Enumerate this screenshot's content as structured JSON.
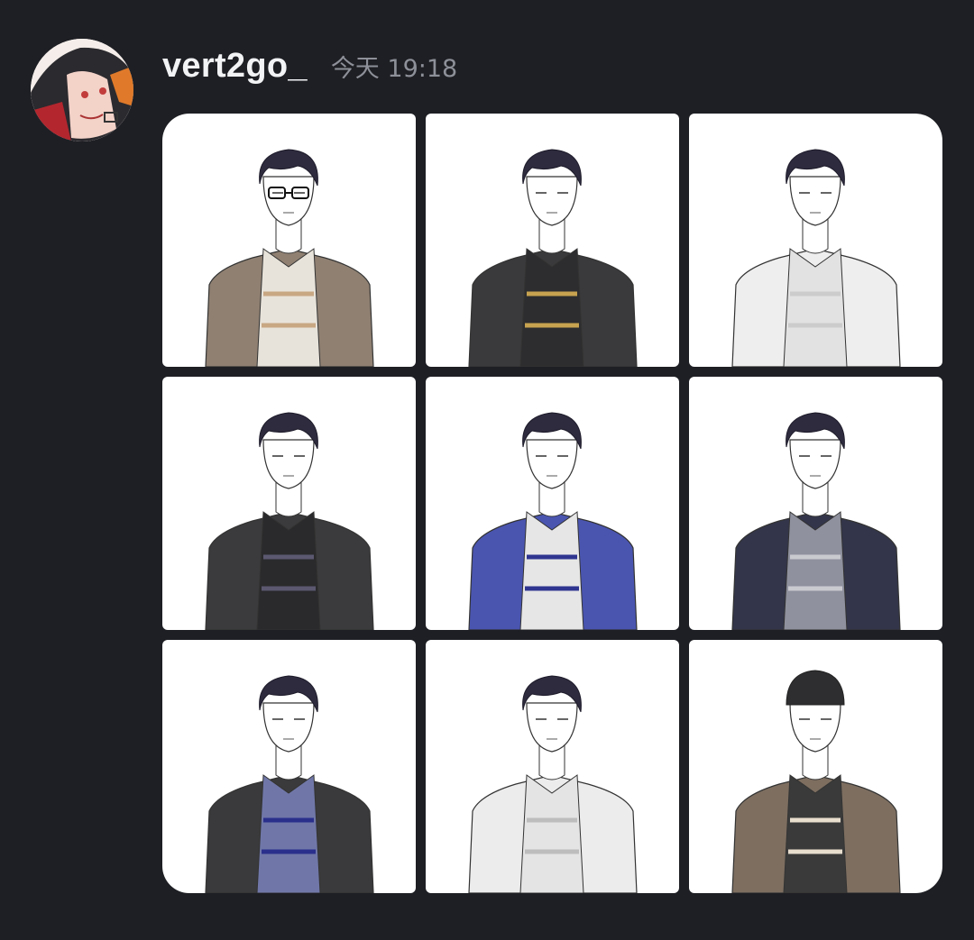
{
  "message": {
    "author": "vert2go_",
    "timestamp": "今天 19:18",
    "avatar_icon": "anime-avatar-icon",
    "attachments": [
      {
        "outfit": "coat-sweater",
        "glasses": true,
        "hat": false,
        "colors": {
          "jacket": "#8f8072",
          "inner": "#e8e3da",
          "accent": "#c8a783"
        }
      },
      {
        "outfit": "military-uniform",
        "glasses": false,
        "hat": false,
        "colors": {
          "jacket": "#3a3a3c",
          "inner": "#2d2d2f",
          "accent": "#c7a24f"
        }
      },
      {
        "outfit": "white-wrap-robe",
        "glasses": false,
        "hat": false,
        "colors": {
          "jacket": "#eeeeee",
          "inner": "#e2e2e2",
          "accent": "#cccccc"
        }
      },
      {
        "outfit": "black-turtleneck-plaid-scarf",
        "glasses": false,
        "hat": false,
        "colors": {
          "jacket": "#3b3b3d",
          "inner": "#2a2a2c",
          "accent": "#5b5870"
        }
      },
      {
        "outfit": "blue-shirt-white-vest",
        "glasses": false,
        "hat": false,
        "colors": {
          "jacket": "#4a55b0",
          "inner": "#e6e6e6",
          "accent": "#2f3590"
        }
      },
      {
        "outfit": "leather-jacket-grey-tee",
        "glasses": false,
        "hat": false,
        "colors": {
          "jacket": "#33354a",
          "inner": "#8f919e",
          "accent": "#c9c9d0"
        }
      },
      {
        "outfit": "suit-striped-vest-tie",
        "glasses": false,
        "hat": false,
        "colors": {
          "jacket": "#3a3a3c",
          "inner": "#7077a8",
          "accent": "#2a2f8c"
        }
      },
      {
        "outfit": "white-polo",
        "glasses": false,
        "hat": false,
        "colors": {
          "jacket": "#ececec",
          "inner": "#e4e4e4",
          "accent": "#bdbdbd"
        }
      },
      {
        "outfit": "shearling-jacket-beanie",
        "glasses": false,
        "hat": true,
        "colors": {
          "jacket": "#7d6e60",
          "inner": "#3a3a3a",
          "accent": "#e9dfcf"
        }
      }
    ]
  }
}
